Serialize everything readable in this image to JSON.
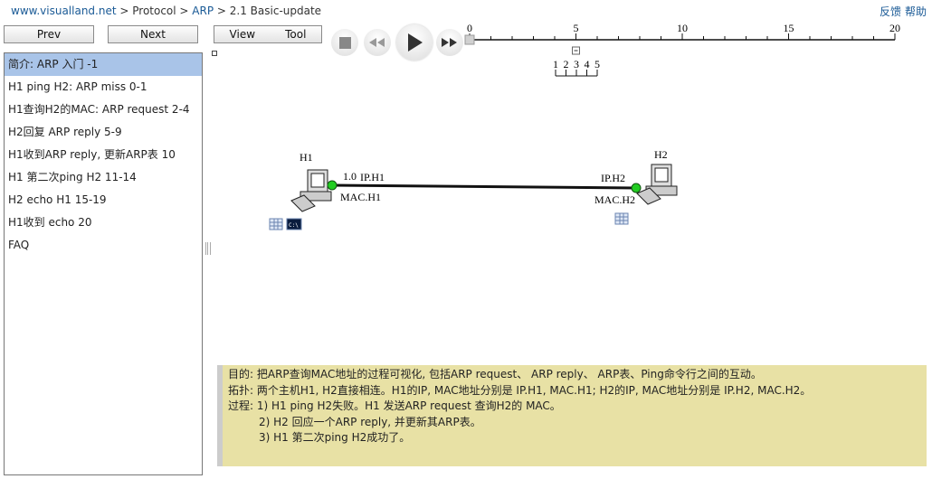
{
  "breadcrumb": {
    "site": "www.visualland.net",
    "sep": " > ",
    "protocol": "Protocol",
    "arp": "ARP",
    "page": "2.1 Basic-update"
  },
  "top_links": {
    "feedback": "反馈",
    "help": "帮助"
  },
  "nav": {
    "prev": "Prev",
    "next": "Next",
    "view": "View",
    "tool": "Tool"
  },
  "sidebar": {
    "items": [
      {
        "label": "简介: ARP 入门 -1",
        "active": true
      },
      {
        "label": "H1 ping H2: ARP miss 0-1"
      },
      {
        "label": "H1查询H2的MAC: ARP request 2-4"
      },
      {
        "label": "H2回复 ARP reply 5-9"
      },
      {
        "label": "H1收到ARP reply, 更新ARP表 10"
      },
      {
        "label": "H1 第二次ping H2 11-14"
      },
      {
        "label": "H2 echo H1 15-19"
      },
      {
        "label": "H1收到 echo 20"
      },
      {
        "label": "FAQ"
      }
    ]
  },
  "player": {
    "controls": [
      "stop",
      "rewind",
      "play",
      "fast-forward"
    ],
    "timeline": {
      "min": 0,
      "max": 20,
      "major_labels": [
        "0",
        "5",
        "10",
        "15",
        "20"
      ],
      "current": 0
    },
    "sub_steps": [
      "1",
      "2",
      "3",
      "4",
      "5"
    ],
    "collapse_symbol": "−"
  },
  "diagram": {
    "h1": {
      "name": "H1",
      "ip": "IP.H1",
      "mac": "MAC.H1",
      "time_label": "1.0"
    },
    "h2": {
      "name": "H2",
      "ip": "IP.H2",
      "mac": "MAC.H2"
    },
    "link_color": "#111111",
    "port_color": "#22cc22",
    "cmd_icon_text": "C:\\"
  },
  "description": {
    "line1": "目的:  把ARP查询MAC地址的过程可视化, 包括ARP request、 ARP reply、 ARP表、Ping命令行之间的互动。",
    "line2": "拓扑: 两个主机H1, H2直接相连。H1的IP, MAC地址分别是 IP.H1, MAC.H1; H2的IP, MAC地址分别是 IP.H2, MAC.H2。",
    "line3": "过程: 1) H1 ping H2失败。H1 发送ARP request 查询H2的 MAC。",
    "line4": "2) H2 回应一个ARP reply, 并更新其ARP表。",
    "line5": "3) H1 第二次ping H2成功了。"
  }
}
